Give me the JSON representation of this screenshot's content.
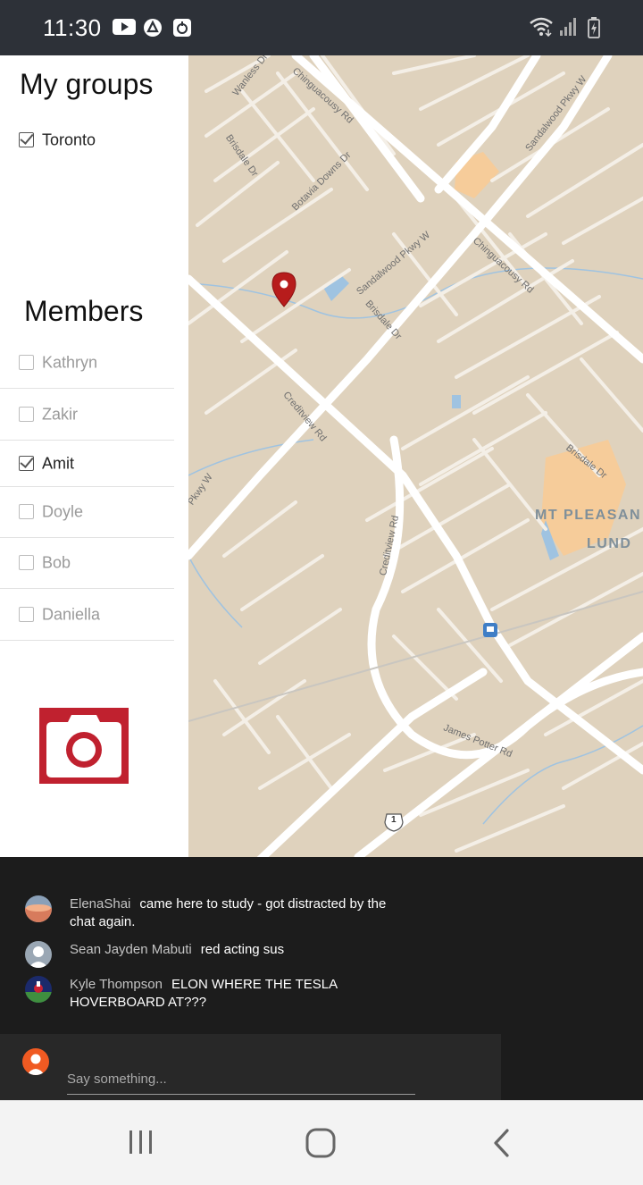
{
  "status_bar": {
    "time": "11:30",
    "left_icons": [
      "youtube-icon",
      "app-triangle-icon",
      "app-square-icon"
    ],
    "right_icons": [
      "wifi-icon",
      "signal-icon",
      "battery-charging-icon"
    ]
  },
  "groups": {
    "title": "My groups",
    "items": [
      {
        "label": "Toronto",
        "checked": true
      }
    ]
  },
  "members": {
    "title": "Members",
    "items": [
      {
        "label": "Kathryn",
        "checked": false
      },
      {
        "label": "Zakir",
        "checked": false
      },
      {
        "label": "Amit",
        "checked": true
      },
      {
        "label": "Doyle",
        "checked": false
      },
      {
        "label": "Bob",
        "checked": false
      },
      {
        "label": "Daniella",
        "checked": false
      }
    ]
  },
  "camera": {
    "icon": "camera-icon",
    "color": "#c0212f"
  },
  "map": {
    "street_labels": [
      "Wanless Dr",
      "Chinguacousy Rd",
      "Brisdale Dr",
      "Botavia Downs Dr",
      "Sandalwood Pkwy W",
      "Chinguacousy Rd",
      "Brisdale Dr",
      "Creditview Rd",
      "Creditview Rd",
      "Brisdale Dr",
      "James Potter Rd",
      "Sandalwood Pkwy W",
      "Pkwy W"
    ],
    "area_labels": [
      "MT PLEASAN",
      "LUND"
    ],
    "highway_shield": "1",
    "marker_color": "#b71c1c"
  },
  "chat": {
    "messages": [
      {
        "author": "ElenaShai",
        "text": "came here to study - got distracted by the chat again."
      },
      {
        "author": "Sean Jayden Mabuti",
        "text": "red acting sus"
      },
      {
        "author": "Kyle Thompson",
        "text": "ELON WHERE THE TESLA HOVERBOARD AT???"
      }
    ],
    "input_placeholder": "Say something..."
  },
  "nav_bar": {
    "buttons": [
      "recents-icon",
      "home-icon",
      "back-icon"
    ]
  }
}
